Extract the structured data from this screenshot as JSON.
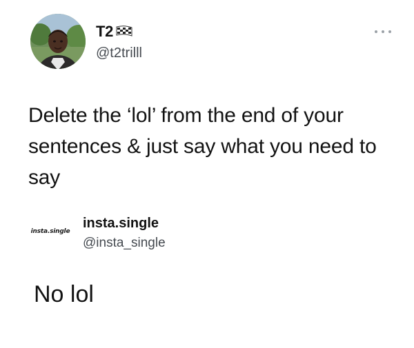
{
  "tweet_1": {
    "display_name": "T2",
    "name_icon": "checkered-flag-icon",
    "handle": "@t2trilll",
    "more_icon": "more-options-icon",
    "text": "Delete the ‘lol’ from the end of your sentences & just say what you need to say"
  },
  "tweet_2": {
    "avatar_label": "insta.single",
    "display_name": "insta.single",
    "handle": "@insta_single",
    "text": "No lol"
  },
  "colors": {
    "text": "#111111",
    "handle": "#454a50",
    "more_dots": "#9aa0a6",
    "background": "#ffffff"
  }
}
